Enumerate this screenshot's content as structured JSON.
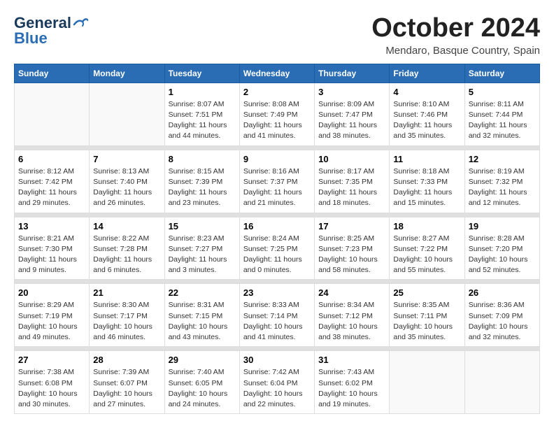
{
  "logo": {
    "line1": "General",
    "line2": "Blue"
  },
  "title": "October 2024",
  "location": "Mendaro, Basque Country, Spain",
  "headers": [
    "Sunday",
    "Monday",
    "Tuesday",
    "Wednesday",
    "Thursday",
    "Friday",
    "Saturday"
  ],
  "weeks": [
    [
      {
        "day": "",
        "sunrise": "",
        "sunset": "",
        "daylight": ""
      },
      {
        "day": "",
        "sunrise": "",
        "sunset": "",
        "daylight": ""
      },
      {
        "day": "1",
        "sunrise": "Sunrise: 8:07 AM",
        "sunset": "Sunset: 7:51 PM",
        "daylight": "Daylight: 11 hours and 44 minutes."
      },
      {
        "day": "2",
        "sunrise": "Sunrise: 8:08 AM",
        "sunset": "Sunset: 7:49 PM",
        "daylight": "Daylight: 11 hours and 41 minutes."
      },
      {
        "day": "3",
        "sunrise": "Sunrise: 8:09 AM",
        "sunset": "Sunset: 7:47 PM",
        "daylight": "Daylight: 11 hours and 38 minutes."
      },
      {
        "day": "4",
        "sunrise": "Sunrise: 8:10 AM",
        "sunset": "Sunset: 7:46 PM",
        "daylight": "Daylight: 11 hours and 35 minutes."
      },
      {
        "day": "5",
        "sunrise": "Sunrise: 8:11 AM",
        "sunset": "Sunset: 7:44 PM",
        "daylight": "Daylight: 11 hours and 32 minutes."
      }
    ],
    [
      {
        "day": "6",
        "sunrise": "Sunrise: 8:12 AM",
        "sunset": "Sunset: 7:42 PM",
        "daylight": "Daylight: 11 hours and 29 minutes."
      },
      {
        "day": "7",
        "sunrise": "Sunrise: 8:13 AM",
        "sunset": "Sunset: 7:40 PM",
        "daylight": "Daylight: 11 hours and 26 minutes."
      },
      {
        "day": "8",
        "sunrise": "Sunrise: 8:15 AM",
        "sunset": "Sunset: 7:39 PM",
        "daylight": "Daylight: 11 hours and 23 minutes."
      },
      {
        "day": "9",
        "sunrise": "Sunrise: 8:16 AM",
        "sunset": "Sunset: 7:37 PM",
        "daylight": "Daylight: 11 hours and 21 minutes."
      },
      {
        "day": "10",
        "sunrise": "Sunrise: 8:17 AM",
        "sunset": "Sunset: 7:35 PM",
        "daylight": "Daylight: 11 hours and 18 minutes."
      },
      {
        "day": "11",
        "sunrise": "Sunrise: 8:18 AM",
        "sunset": "Sunset: 7:33 PM",
        "daylight": "Daylight: 11 hours and 15 minutes."
      },
      {
        "day": "12",
        "sunrise": "Sunrise: 8:19 AM",
        "sunset": "Sunset: 7:32 PM",
        "daylight": "Daylight: 11 hours and 12 minutes."
      }
    ],
    [
      {
        "day": "13",
        "sunrise": "Sunrise: 8:21 AM",
        "sunset": "Sunset: 7:30 PM",
        "daylight": "Daylight: 11 hours and 9 minutes."
      },
      {
        "day": "14",
        "sunrise": "Sunrise: 8:22 AM",
        "sunset": "Sunset: 7:28 PM",
        "daylight": "Daylight: 11 hours and 6 minutes."
      },
      {
        "day": "15",
        "sunrise": "Sunrise: 8:23 AM",
        "sunset": "Sunset: 7:27 PM",
        "daylight": "Daylight: 11 hours and 3 minutes."
      },
      {
        "day": "16",
        "sunrise": "Sunrise: 8:24 AM",
        "sunset": "Sunset: 7:25 PM",
        "daylight": "Daylight: 11 hours and 0 minutes."
      },
      {
        "day": "17",
        "sunrise": "Sunrise: 8:25 AM",
        "sunset": "Sunset: 7:23 PM",
        "daylight": "Daylight: 10 hours and 58 minutes."
      },
      {
        "day": "18",
        "sunrise": "Sunrise: 8:27 AM",
        "sunset": "Sunset: 7:22 PM",
        "daylight": "Daylight: 10 hours and 55 minutes."
      },
      {
        "day": "19",
        "sunrise": "Sunrise: 8:28 AM",
        "sunset": "Sunset: 7:20 PM",
        "daylight": "Daylight: 10 hours and 52 minutes."
      }
    ],
    [
      {
        "day": "20",
        "sunrise": "Sunrise: 8:29 AM",
        "sunset": "Sunset: 7:19 PM",
        "daylight": "Daylight: 10 hours and 49 minutes."
      },
      {
        "day": "21",
        "sunrise": "Sunrise: 8:30 AM",
        "sunset": "Sunset: 7:17 PM",
        "daylight": "Daylight: 10 hours and 46 minutes."
      },
      {
        "day": "22",
        "sunrise": "Sunrise: 8:31 AM",
        "sunset": "Sunset: 7:15 PM",
        "daylight": "Daylight: 10 hours and 43 minutes."
      },
      {
        "day": "23",
        "sunrise": "Sunrise: 8:33 AM",
        "sunset": "Sunset: 7:14 PM",
        "daylight": "Daylight: 10 hours and 41 minutes."
      },
      {
        "day": "24",
        "sunrise": "Sunrise: 8:34 AM",
        "sunset": "Sunset: 7:12 PM",
        "daylight": "Daylight: 10 hours and 38 minutes."
      },
      {
        "day": "25",
        "sunrise": "Sunrise: 8:35 AM",
        "sunset": "Sunset: 7:11 PM",
        "daylight": "Daylight: 10 hours and 35 minutes."
      },
      {
        "day": "26",
        "sunrise": "Sunrise: 8:36 AM",
        "sunset": "Sunset: 7:09 PM",
        "daylight": "Daylight: 10 hours and 32 minutes."
      }
    ],
    [
      {
        "day": "27",
        "sunrise": "Sunrise: 7:38 AM",
        "sunset": "Sunset: 6:08 PM",
        "daylight": "Daylight: 10 hours and 30 minutes."
      },
      {
        "day": "28",
        "sunrise": "Sunrise: 7:39 AM",
        "sunset": "Sunset: 6:07 PM",
        "daylight": "Daylight: 10 hours and 27 minutes."
      },
      {
        "day": "29",
        "sunrise": "Sunrise: 7:40 AM",
        "sunset": "Sunset: 6:05 PM",
        "daylight": "Daylight: 10 hours and 24 minutes."
      },
      {
        "day": "30",
        "sunrise": "Sunrise: 7:42 AM",
        "sunset": "Sunset: 6:04 PM",
        "daylight": "Daylight: 10 hours and 22 minutes."
      },
      {
        "day": "31",
        "sunrise": "Sunrise: 7:43 AM",
        "sunset": "Sunset: 6:02 PM",
        "daylight": "Daylight: 10 hours and 19 minutes."
      },
      {
        "day": "",
        "sunrise": "",
        "sunset": "",
        "daylight": ""
      },
      {
        "day": "",
        "sunrise": "",
        "sunset": "",
        "daylight": ""
      }
    ]
  ]
}
